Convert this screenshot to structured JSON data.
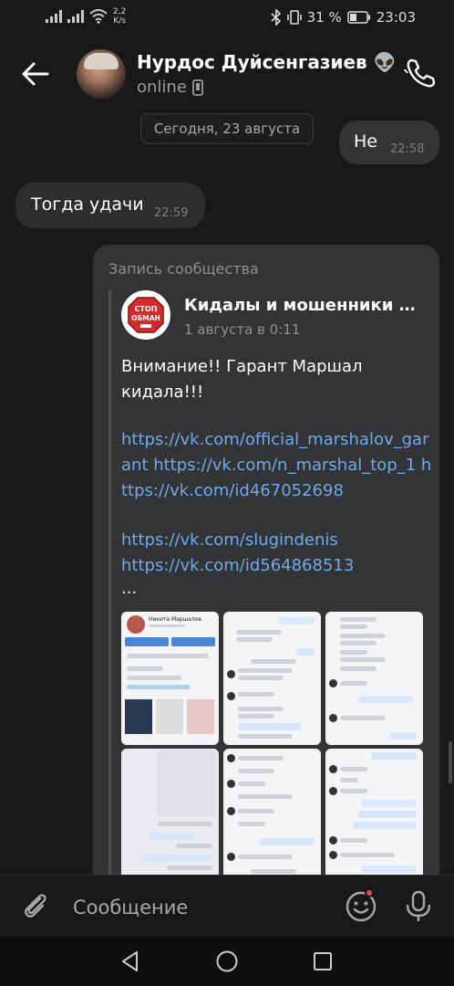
{
  "status_bar": {
    "network_speed": "2,2",
    "network_unit": "K/s",
    "battery": "31 %",
    "time": "23:03"
  },
  "header": {
    "contact_name": "Нурдос Дуйсенгазиев",
    "contact_emoji": "👽 ˎ",
    "status": "online"
  },
  "date_divider": "Сегодня, 23 августа",
  "messages": [
    {
      "direction": "out",
      "text": "Не",
      "time": "22:58"
    },
    {
      "direction": "in",
      "text": "Тогда удачи",
      "time": "22:59"
    }
  ],
  "repost": {
    "label": "Запись сообщества",
    "group_name": "Кидалы и мошенники в v...",
    "group_avatar_text": "СТОП ОБМАН",
    "date": "1 августа в 0:11",
    "text": "Внимание!! Гарант Маршал кидала!!!",
    "links_block_1": "https://vk.com/official_marshalov_garant https://vk.com/n_marshal_top_1 https://vk.com/id467052698",
    "links_block_2_a": "https://vk.com/slugindenis",
    "links_block_2_b": "https://vk.com/id564868513",
    "ellipsis": "...",
    "thumb_profile_name": "Никита Маршалов"
  },
  "input": {
    "placeholder": "Сообщение"
  },
  "colors": {
    "background": "#19191a",
    "bubble": "#333436",
    "link": "#71aaeb",
    "notification": "#e64646"
  }
}
